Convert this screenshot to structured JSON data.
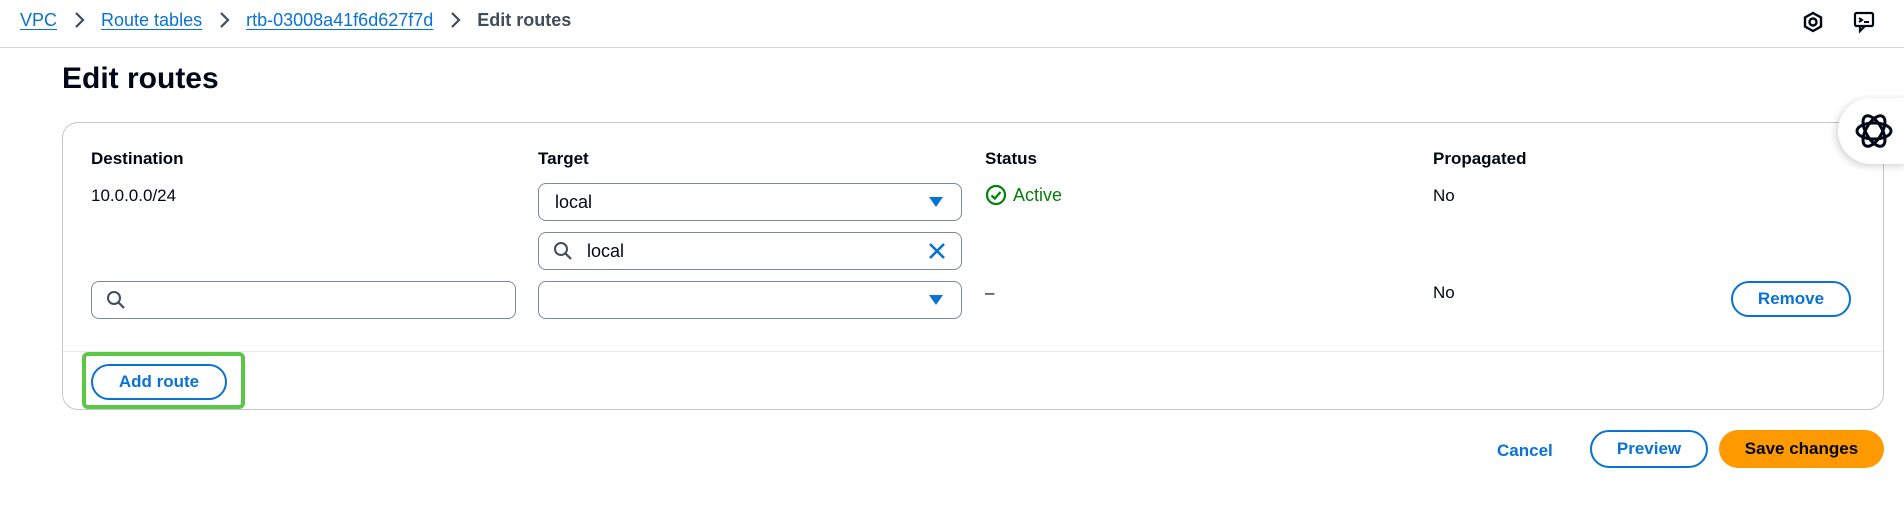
{
  "breadcrumb": {
    "items": [
      "VPC",
      "Route tables",
      "rtb-03008a41f6d627f7d"
    ],
    "current": "Edit routes"
  },
  "page": {
    "title": "Edit routes"
  },
  "table": {
    "headers": {
      "destination": "Destination",
      "target": "Target",
      "status": "Status",
      "propagated": "Propagated"
    },
    "rows": [
      {
        "destination": "10.0.0.0/24",
        "target_value": "local",
        "target_filter": "local",
        "status": "Active",
        "propagated": "No"
      },
      {
        "destination": "",
        "target_value": "",
        "status": "–",
        "propagated": "No",
        "remove_label": "Remove"
      }
    ]
  },
  "add_route_label": "Add route",
  "actions": {
    "cancel": "Cancel",
    "preview": "Preview",
    "save": "Save changes"
  },
  "colors": {
    "link": "#0972d3",
    "status_ok": "#037f0c",
    "primary_button": "#ff9900",
    "highlight": "#5ac844"
  },
  "icons": {
    "top_right": [
      "cloudshell-icon",
      "feedback-icon"
    ],
    "floating": "openai-logo-icon"
  }
}
